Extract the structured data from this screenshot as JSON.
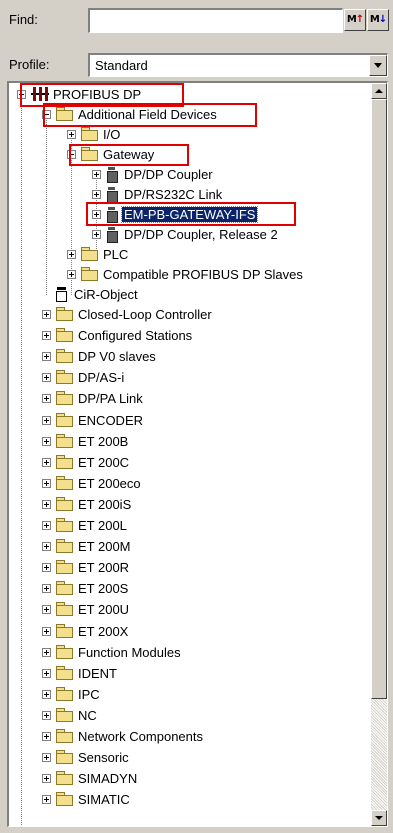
{
  "find": {
    "label": "Find:",
    "value": "",
    "search_up_icon": "find-up-icon",
    "search_down_icon": "find-down-icon"
  },
  "profile": {
    "label": "Profile:",
    "value": "Standard"
  },
  "tree": {
    "root": "PROFIBUS DP",
    "additional_field_devices": "Additional Field Devices",
    "io": "I/O",
    "gateway": "Gateway",
    "gateway_items": [
      "DP/DP Coupler",
      "DP/RS232C Link",
      "EM-PB-GATEWAY-IFS",
      "DP/DP Coupler, Release 2"
    ],
    "plc": "PLC",
    "compatible": "Compatible PROFIBUS DP Slaves",
    "cir_object": "CiR-Object",
    "folders": [
      "Closed-Loop Controller",
      "Configured Stations",
      "DP V0 slaves",
      "DP/AS-i",
      "DP/PA Link",
      "ENCODER",
      "ET 200B",
      "ET 200C",
      "ET 200eco",
      "ET 200iS",
      "ET 200L",
      "ET 200M",
      "ET 200R",
      "ET 200S",
      "ET 200U",
      "ET 200X",
      "Function Modules",
      "IDENT",
      "IPC",
      "NC",
      "Network Components",
      "Sensoric",
      "SIMADYN",
      "SIMATIC"
    ],
    "selected": "EM-PB-GATEWAY-IFS"
  },
  "colors": {
    "highlight_box": "#e00000",
    "selection": "#0a246a",
    "folder": "#f4e08c"
  }
}
